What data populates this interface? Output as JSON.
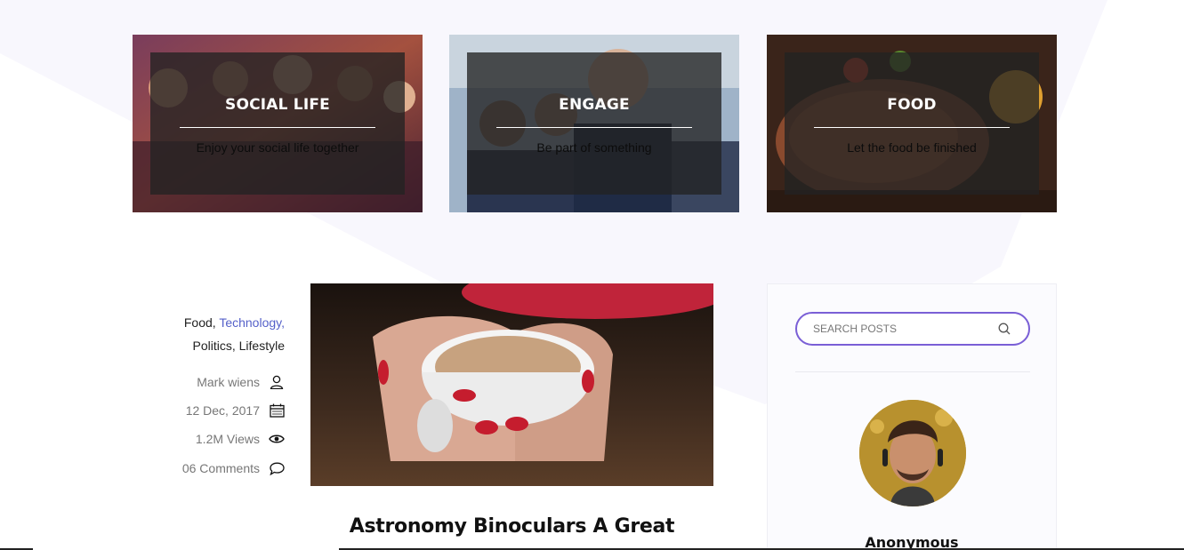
{
  "categories": [
    {
      "title": "SOCIAL LIFE",
      "subtitle": "Enjoy your social life together",
      "image_icon": "party-crowd-image"
    },
    {
      "title": "ENGAGE",
      "subtitle": "Be part of something",
      "image_icon": "business-people-image"
    },
    {
      "title": "FOOD",
      "subtitle": "Let the food be finished",
      "image_icon": "grilled-steak-image"
    }
  ],
  "post": {
    "tags": [
      {
        "label": "Food",
        "sep": ", ",
        "highlight": false
      },
      {
        "label": "Technology,",
        "sep": "",
        "highlight": true
      },
      {
        "label": "Politics",
        "sep": ", ",
        "highlight": false
      },
      {
        "label": "Lifestyle",
        "sep": "",
        "highlight": false
      }
    ],
    "author": "Mark wiens",
    "date": "12 Dec, 2017",
    "views": "1.2M Views",
    "comments": "06 Comments",
    "title": "Astronomy Binoculars A Great",
    "image_icon": "coffee-cup-image"
  },
  "sidebar": {
    "search_placeholder": "SEARCH POSTS",
    "author_name": "Anonymous",
    "avatar_icon": "author-avatar"
  },
  "colors": {
    "accent": "#7a5fd6",
    "link": "#5561c9",
    "overlay": "#222222"
  }
}
